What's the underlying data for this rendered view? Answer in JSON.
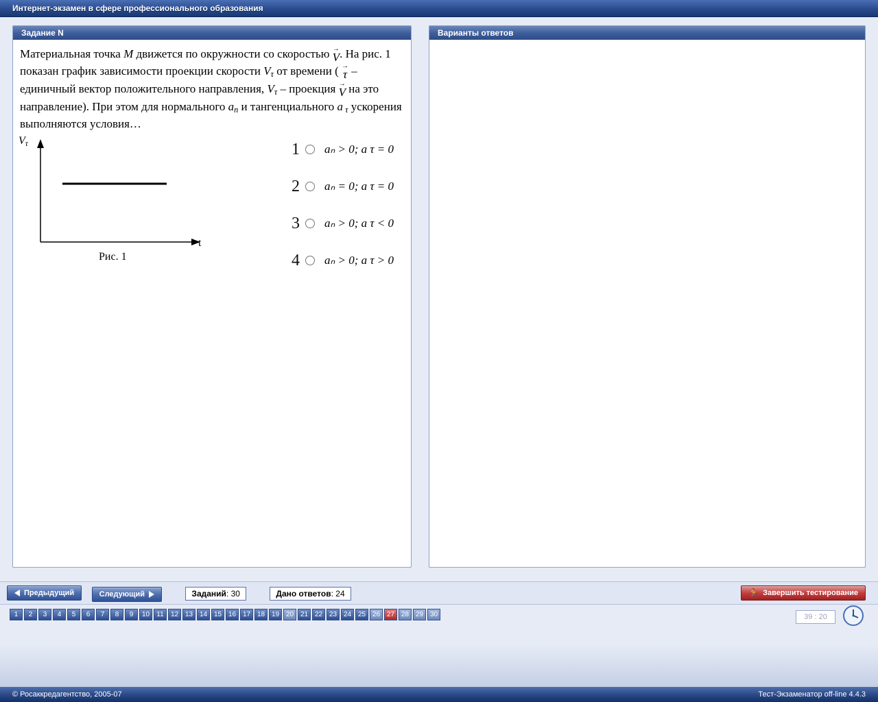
{
  "title": "Интернет-экзамен в сфере профессионального образования",
  "left_panel_title": "Задание N",
  "right_panel_title": "Варианты ответов",
  "prompt_parts": {
    "p1": "Материальная точка ",
    "M": "M",
    "p2": " движется по окружности со скоростью ",
    "V": "V",
    "p3": ". На рис. 1 показан график зависимости проекции скорости ",
    "Vt": "V",
    "p4": " от времени ( ",
    "tau": "τ",
    "p5": " – единичный вектор положительного направления, ",
    "p5b": " – проекция ",
    "p6": " на это направление). При этом для нормального ",
    "an": "a",
    "p7": " и тангенциального ",
    "at": "a",
    "p8": " ускорения выполняются условия…"
  },
  "fig_caption": "Рис. 1",
  "fig_y": "V",
  "fig_x": "t",
  "options": [
    {
      "num": "1",
      "text": "aₙ > 0; a τ = 0"
    },
    {
      "num": "2",
      "text": "aₙ = 0; a τ = 0"
    },
    {
      "num": "3",
      "text": "aₙ > 0; a τ < 0"
    },
    {
      "num": "4",
      "text": "aₙ > 0; a τ > 0"
    }
  ],
  "chart_data": {
    "type": "line",
    "title": "V_tau vs t",
    "xlabel": "t",
    "ylabel": "V_tau",
    "series": [
      {
        "name": "V_tau",
        "values": "constant positive (horizontal line)"
      }
    ],
    "description": "Horizontal line at constant positive V_tau over time"
  },
  "nav": {
    "prev": "Предыдущий",
    "next": "Следующий",
    "total_label": "Заданий",
    "total": "30",
    "answered_label": "Дано ответов",
    "answered": "24",
    "finish": "Завершить тестирование"
  },
  "qcells": [
    {
      "n": "1",
      "s": "answered"
    },
    {
      "n": "2",
      "s": "answered"
    },
    {
      "n": "3",
      "s": "answered"
    },
    {
      "n": "4",
      "s": "answered"
    },
    {
      "n": "5",
      "s": "answered"
    },
    {
      "n": "6",
      "s": "answered"
    },
    {
      "n": "7",
      "s": "answered"
    },
    {
      "n": "8",
      "s": "answered"
    },
    {
      "n": "9",
      "s": "answered"
    },
    {
      "n": "10",
      "s": "answered"
    },
    {
      "n": "11",
      "s": "answered"
    },
    {
      "n": "12",
      "s": "answered"
    },
    {
      "n": "13",
      "s": "answered"
    },
    {
      "n": "14",
      "s": "answered"
    },
    {
      "n": "15",
      "s": "answered"
    },
    {
      "n": "16",
      "s": "answered"
    },
    {
      "n": "17",
      "s": "answered"
    },
    {
      "n": "18",
      "s": "answered"
    },
    {
      "n": "19",
      "s": "answered"
    },
    {
      "n": "20",
      "s": "open"
    },
    {
      "n": "21",
      "s": "answered"
    },
    {
      "n": "22",
      "s": "answered"
    },
    {
      "n": "23",
      "s": "answered"
    },
    {
      "n": "24",
      "s": "answered"
    },
    {
      "n": "25",
      "s": "answered"
    },
    {
      "n": "26",
      "s": "open"
    },
    {
      "n": "27",
      "s": "current"
    },
    {
      "n": "28",
      "s": "open"
    },
    {
      "n": "29",
      "s": "open"
    },
    {
      "n": "30",
      "s": "open"
    }
  ],
  "timer": "39 : 20",
  "copyright_left": "© Росаккредагентство, 2005-07",
  "copyright_right": "Тест-Экзаменатор off-line 4.4.3"
}
